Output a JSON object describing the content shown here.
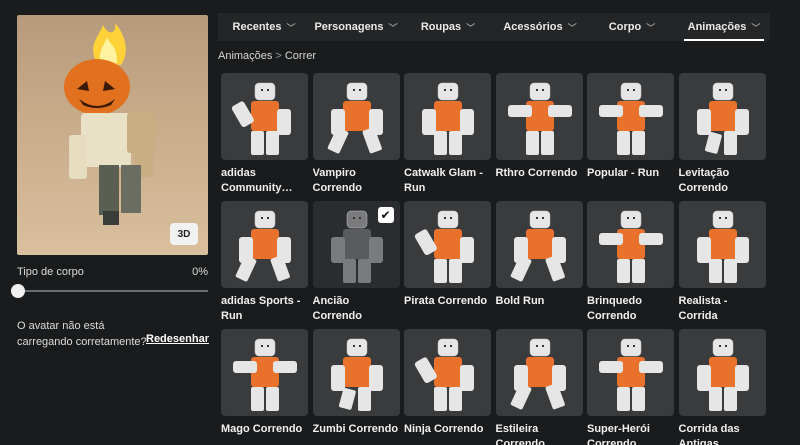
{
  "avatar": {
    "view_3d_label": "3D"
  },
  "body_type": {
    "label": "Tipo de corpo",
    "value": "0%"
  },
  "loading_message": "O avatar não está carregando corretamente?",
  "redraw_label": "Redesenhar",
  "tabs": [
    {
      "label": "Recentes",
      "active": false
    },
    {
      "label": "Personagens",
      "active": false
    },
    {
      "label": "Roupas",
      "active": false
    },
    {
      "label": "Acessórios",
      "active": false
    },
    {
      "label": "Corpo",
      "active": false
    },
    {
      "label": "Animações",
      "active": true
    }
  ],
  "breadcrumb": {
    "parent": "Animações",
    "separator": ">",
    "current": "Correr"
  },
  "items": [
    {
      "label": "adidas Community…",
      "pose": "lean"
    },
    {
      "label": "Vampiro Correndo",
      "pose": "stride"
    },
    {
      "label": "Catwalk Glam - Run",
      "pose": "walk"
    },
    {
      "label": "Rthro Correndo",
      "pose": "arms"
    },
    {
      "label": "Popular - Run",
      "pose": "arms"
    },
    {
      "label": "Levitação Correndo",
      "pose": "float"
    },
    {
      "label": "adidas Sports - Run",
      "pose": "stride"
    },
    {
      "label": "Ancião Correndo",
      "pose": "dark",
      "selected": true
    },
    {
      "label": "Pirata Correndo",
      "pose": "lean"
    },
    {
      "label": "Bold Run",
      "pose": "stride"
    },
    {
      "label": "Brinquedo Correndo",
      "pose": "arms"
    },
    {
      "label": "Realista - Corrida",
      "pose": "walk"
    },
    {
      "label": "Mago Correndo",
      "pose": "arms"
    },
    {
      "label": "Zumbi Correndo",
      "pose": "float"
    },
    {
      "label": "Ninja Correndo",
      "pose": "lean"
    },
    {
      "label": "Estileira Correndo",
      "pose": "stride"
    },
    {
      "label": "Super-Herói Correndo",
      "pose": "arms"
    },
    {
      "label": "Corrida das Antigas",
      "pose": "walk"
    }
  ],
  "colors": {
    "shirt": "#e8712b",
    "limb": "#e6e6e6",
    "selected_shirt": "#5a5b5d"
  },
  "check_icon": "checkmark-icon"
}
